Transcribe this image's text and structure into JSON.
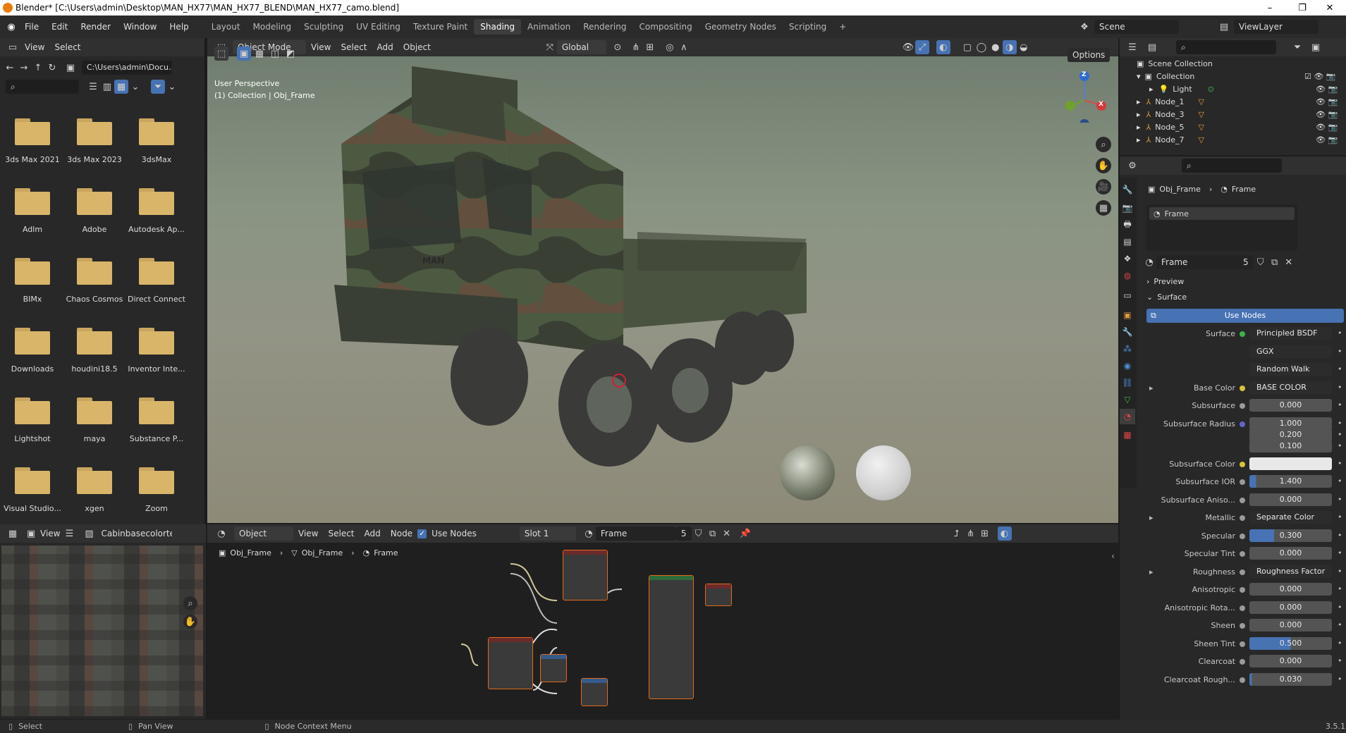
{
  "window": {
    "title": "Blender* [C:\\Users\\admin\\Desktop\\MAN_HX77\\MAN_HX77_BLEND\\MAN_HX77_camo.blend]",
    "minimize": "–",
    "maximize": "❐",
    "close": "✕"
  },
  "menu": {
    "items": [
      "File",
      "Edit",
      "Render",
      "Window",
      "Help"
    ]
  },
  "workspaces": {
    "tabs": [
      "Layout",
      "Modeling",
      "Sculpting",
      "UV Editing",
      "Texture Paint",
      "Shading",
      "Animation",
      "Rendering",
      "Compositing",
      "Geometry Nodes",
      "Scripting"
    ],
    "active": "Shading",
    "add": "+"
  },
  "scene": {
    "name": "Scene",
    "view_layer": "ViewLayer"
  },
  "filebrowser": {
    "menu": [
      "View",
      "Select"
    ],
    "path": "C:\\Users\\admin\\Docu...",
    "folders": [
      "3ds Max 2021",
      "3ds Max 2023",
      "3dsMax",
      "Adlm",
      "Adobe",
      "Autodesk Ap...",
      "BIMx",
      "Chaos Cosmos",
      "Direct Connect",
      "Downloads",
      "houdini18.5",
      "Inventor Inte...",
      "Lightshot",
      "maya",
      "Substance P...",
      "Visual Studio...",
      "xgen",
      "Zoom"
    ]
  },
  "viewport": {
    "mode": "Object Mode",
    "menu": [
      "View",
      "Select",
      "Add",
      "Object"
    ],
    "orientation": "Global",
    "options": "Options",
    "overlay_line1": "User Perspective",
    "overlay_line2": "(1) Collection | Obj_Frame",
    "gizmo": {
      "z": "Z",
      "x": "X"
    },
    "truck_brand": "MAN"
  },
  "image_editor": {
    "view": "View",
    "image": "Cabinbasecolortext"
  },
  "node_editor": {
    "mode": "Object",
    "menu": [
      "View",
      "Select",
      "Add",
      "Node"
    ],
    "use_nodes": "Use Nodes",
    "slot": "Slot 1",
    "material": "Frame",
    "users": "5",
    "breadcrumb": [
      "Obj_Frame",
      "Obj_Frame",
      "Frame"
    ]
  },
  "outliner": {
    "root": "Scene Collection",
    "collection": "Collection",
    "items": [
      "Light",
      "Node_1",
      "Node_3",
      "Node_5",
      "Node_7"
    ]
  },
  "properties": {
    "breadcrumb_obj": "Obj_Frame",
    "breadcrumb_mat": "Frame",
    "slot_name": "Frame",
    "material_name": "Frame",
    "users": "5",
    "panel_preview": "Preview",
    "panel_surface": "Surface",
    "use_nodes": "Use Nodes",
    "rows": [
      {
        "label": "Surface",
        "value": "Principled BSDF",
        "kind": "text",
        "dot": "#3fb24b"
      },
      {
        "label": "",
        "value": "GGX",
        "kind": "dropdown"
      },
      {
        "label": "",
        "value": "Random Walk",
        "kind": "dropdown"
      },
      {
        "label": "Base Color",
        "value": "BASE COLOR",
        "kind": "text",
        "dot": "#d7c23a",
        "expand": true
      },
      {
        "label": "Subsurface",
        "value": "0.000",
        "kind": "num",
        "dot": "#9a9a9a"
      },
      {
        "label": "Subsurface Radius",
        "value": "1.000",
        "kind": "num",
        "dot": "#6266c8"
      },
      {
        "label": "",
        "value": "0.200",
        "kind": "num"
      },
      {
        "label": "",
        "value": "0.100",
        "kind": "num"
      },
      {
        "label": "Subsurface Color",
        "value": "",
        "kind": "color",
        "dot": "#d7c23a"
      },
      {
        "label": "Subsurface IOR",
        "value": "1.400",
        "kind": "num",
        "dot": "#9a9a9a",
        "fill": 0.08
      },
      {
        "label": "Subsurface Aniso...",
        "value": "0.000",
        "kind": "num",
        "dot": "#9a9a9a"
      },
      {
        "label": "Metallic",
        "value": "Separate Color",
        "kind": "text",
        "dot": "#9a9a9a",
        "expand": true
      },
      {
        "label": "Specular",
        "value": "0.300",
        "kind": "num",
        "dot": "#9a9a9a",
        "fill": 0.3
      },
      {
        "label": "Specular Tint",
        "value": "0.000",
        "kind": "num",
        "dot": "#9a9a9a"
      },
      {
        "label": "Roughness",
        "value": "Roughness Factor",
        "kind": "text",
        "dot": "#9a9a9a",
        "expand": true
      },
      {
        "label": "Anisotropic",
        "value": "0.000",
        "kind": "num",
        "dot": "#9a9a9a"
      },
      {
        "label": "Anisotropic Rota...",
        "value": "0.000",
        "kind": "num",
        "dot": "#9a9a9a"
      },
      {
        "label": "Sheen",
        "value": "0.000",
        "kind": "num",
        "dot": "#9a9a9a"
      },
      {
        "label": "Sheen Tint",
        "value": "0.500",
        "kind": "num",
        "dot": "#9a9a9a",
        "fill": 0.5
      },
      {
        "label": "Clearcoat",
        "value": "0.000",
        "kind": "num",
        "dot": "#9a9a9a"
      },
      {
        "label": "Clearcoat Rough...",
        "value": "0.030",
        "kind": "num",
        "dot": "#9a9a9a",
        "fill": 0.03
      }
    ]
  },
  "statusbar": {
    "select": "Select",
    "pan": "Pan View",
    "context": "Node Context Menu",
    "version": "3.5.1"
  }
}
